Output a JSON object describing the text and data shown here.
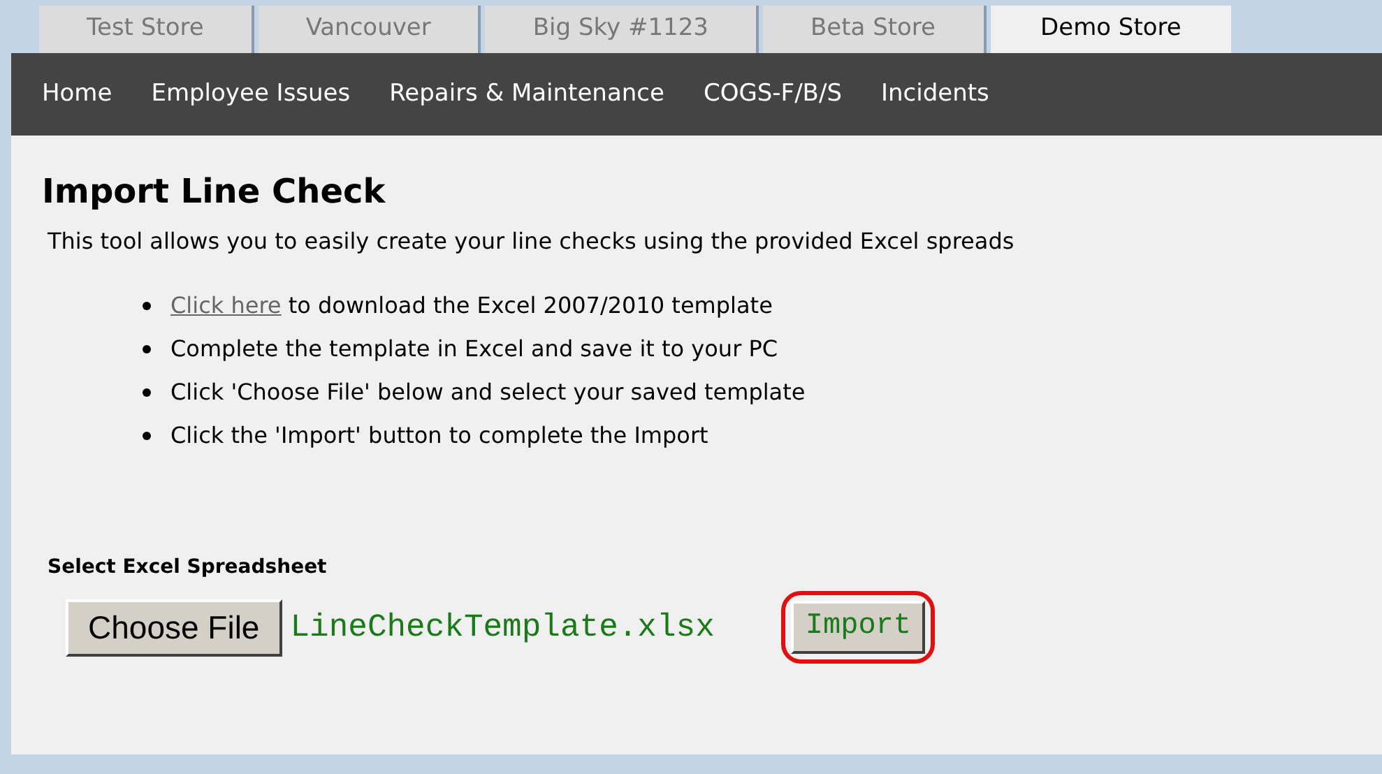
{
  "store_tabs": [
    {
      "label": "Test Store",
      "selected": false
    },
    {
      "label": "Vancouver",
      "selected": false
    },
    {
      "label": "Big Sky #1123",
      "selected": false
    },
    {
      "label": "Beta Store",
      "selected": false
    },
    {
      "label": "Demo Store",
      "selected": true
    }
  ],
  "nav": [
    "Home",
    "Employee Issues",
    "Repairs & Maintenance",
    "COGS-F/B/S",
    "Incidents"
  ],
  "page": {
    "title": "Import Line Check",
    "description": "This tool allows you to easily create your line checks using the provided Excel spreads",
    "steps": [
      {
        "link": "Click here",
        "text": " to download the Excel 2007/2010 template"
      },
      {
        "text": "Complete the template in Excel and save it to your PC"
      },
      {
        "text": "Click 'Choose File' below and select your saved template"
      },
      {
        "text": "Click the 'Import' button to complete the Import"
      }
    ],
    "file_label": "Select Excel Spreadsheet",
    "choose_button": "Choose File",
    "file_name": "LineCheckTemplate.xlsx",
    "import_button": {
      "label": "Import",
      "highlighted": true
    }
  }
}
